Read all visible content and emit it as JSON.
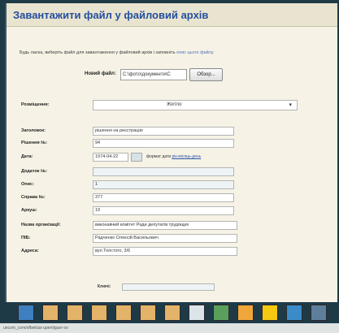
{
  "title": "Завантажити файл у файловий архів",
  "instruction": {
    "text": "Будь ласка, виберіть файл для завантаження у файловий архів і заповніть",
    "link": "опис цього файлу"
  },
  "file": {
    "label": "Новий файл:",
    "value": "C:\\фото\\документи\\С",
    "browse_label": "Обзор..."
  },
  "form": {
    "category": {
      "label": "Розміщення:",
      "value": "Житло"
    },
    "fields": [
      {
        "label": "Заголовок:",
        "value": "рішення на реєстрацію"
      },
      {
        "label": "Рішення №:",
        "value": "94"
      },
      {
        "label": "Дата:",
        "value": "1974-04-22"
      },
      {
        "label": "Додаток №:",
        "value": ""
      },
      {
        "label": "Опис:",
        "value": "1"
      },
      {
        "label": "Справа №:",
        "value": "377"
      },
      {
        "label": "Аркуш:",
        "value": "19"
      },
      {
        "label": "Назва організації:",
        "value": "виконавчий комітет Ради депутатів трудящих"
      },
      {
        "label": "ПІБ:",
        "value": "Радченко Олексій Васильович"
      },
      {
        "label": "Адреса:",
        "value": "вул.Толстого, 3/6"
      }
    ],
    "date_hint": "формат дати",
    "date_hint_link": "рік-місяць-день"
  },
  "bottom": {
    "label": "Ключі:",
    "value": ""
  },
  "toolbar": {
    "icons": [
      {
        "name": "app-icon",
        "color": "#3d7fc1"
      },
      {
        "name": "document-icon",
        "color": "#e3b36a"
      },
      {
        "name": "document-icon",
        "color": "#e3b36a"
      },
      {
        "name": "document-icon",
        "color": "#e3b36a"
      },
      {
        "name": "document-icon",
        "color": "#e3b36a"
      },
      {
        "name": "document-icon",
        "color": "#e3b36a"
      },
      {
        "name": "document-icon",
        "color": "#e3b36a"
      },
      {
        "name": "text-file-icon",
        "color": "#dce4ea"
      },
      {
        "name": "spreadsheet-icon",
        "color": "#5aa05c"
      },
      {
        "name": "media-icon",
        "color": "#f0a73a"
      },
      {
        "name": "star-icon",
        "color": "#f5c90f"
      },
      {
        "name": "computer-icon",
        "color": "#3a8bc9"
      },
      {
        "name": "printer-icon",
        "color": "#5e7f9c"
      }
    ]
  },
  "statusbar": {
    "text": "uncom_com/ofbek/as-upentiguer-oo"
  }
}
